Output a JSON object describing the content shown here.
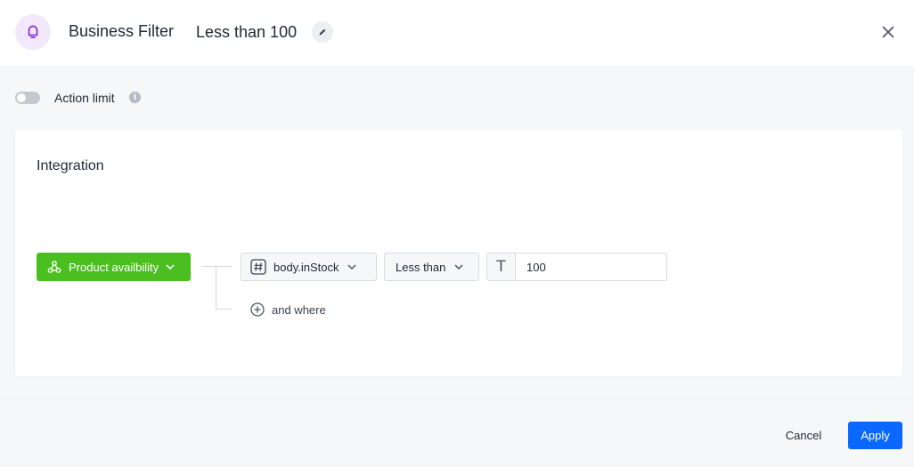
{
  "header": {
    "icon": "bell-icon",
    "title": "Business Filter",
    "name": "Less than 100",
    "edit_icon": "pencil-icon",
    "close_icon": "close-icon"
  },
  "action_limit": {
    "label": "Action limit",
    "enabled": false,
    "info_icon": "info-icon"
  },
  "card": {
    "title": "Integration",
    "source": {
      "label": "Product availbility",
      "icon": "webhook-icon",
      "color": "#4bbf20"
    },
    "condition": {
      "field": "body.inStock",
      "field_icon": "hash-icon",
      "operator": "Less than",
      "value_type_icon": "text-type-icon",
      "value": "100"
    },
    "and_where_label": "and where"
  },
  "footer": {
    "cancel_label": "Cancel",
    "apply_label": "Apply",
    "apply_color": "#0b68ff"
  }
}
